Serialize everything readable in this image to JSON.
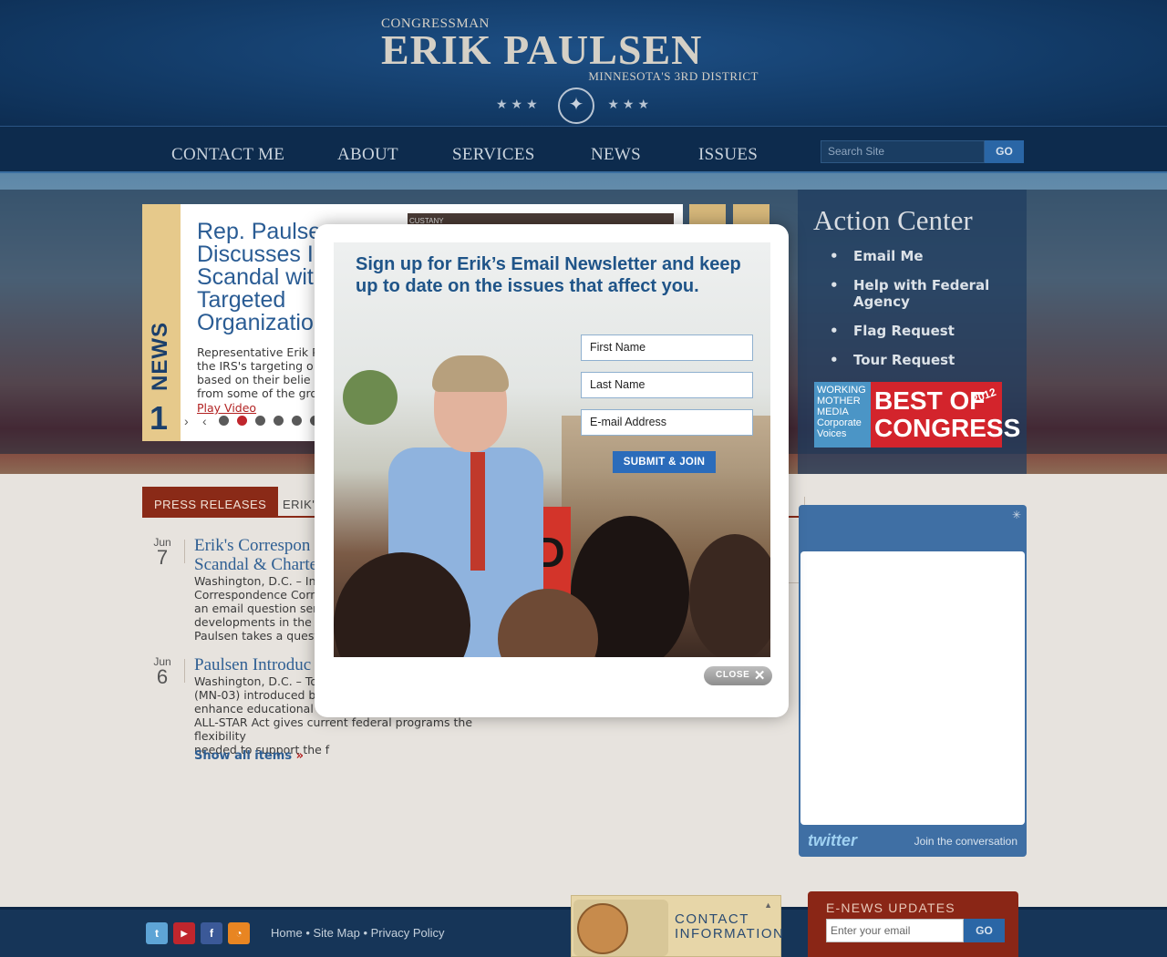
{
  "header": {
    "pre_title": "CONGRESSMAN",
    "name": "ERIK PAULSEN",
    "district": "MINNESOTA'S 3RD DISTRICT",
    "stars": "★★★"
  },
  "nav": {
    "items": [
      "CONTACT ME",
      "ABOUT",
      "SERVICES",
      "NEWS",
      "ISSUES"
    ],
    "search_placeholder": "Search Site",
    "search_button": "GO"
  },
  "slider": {
    "tab_label": "NEWS",
    "number": "1",
    "title": "Rep. Paulse\nDiscusses I\nScandal wit\nTargeted\nOrganizatio",
    "body": "Representative Erik Pa\nthe IRS's targeting o\nbased on their belie\nfrom some of the grou",
    "play_link": "Play Video",
    "thumb_label": "CUSTANY",
    "active_dot": 2
  },
  "action_center": {
    "title": "Action Center",
    "items": [
      "Email Me",
      "Help with Federal Agency",
      "Flag Request",
      "Tour Request"
    ],
    "badge": {
      "left_text": "WORKING MOTHER MEDIA Corporate Voices",
      "main_text": "BEST OF CONGRESS",
      "year": "2012"
    }
  },
  "content": {
    "tabs": [
      "PRESS RELEASES",
      "ERIK'S"
    ],
    "items": [
      {
        "month": "Jun",
        "day": "7",
        "title": "Erik's Correspon\nScandal & Charte",
        "body": "Washington, D.C. – In\nCorrespondence Corne\nan email question sent\ndevelopments in the u\nPaulsen takes a questi"
      },
      {
        "month": "Jun",
        "day": "6",
        "title": "Paulsen Introduc",
        "body": "Washington, D.C. – To\n(MN-03) introduced bi\nenhance educational o\nALL-STAR Act gives current federal programs the flexibility\nneeded to support the f"
      }
    ],
    "show_all": "Show all items",
    "show_all_arrow": "»"
  },
  "twitter": {
    "logo": "twitter",
    "join": "Join the conversation"
  },
  "footer": {
    "links": [
      "Home",
      "Site Map",
      "Privacy Policy"
    ],
    "separator": "•",
    "social_icons": [
      "twitter-icon",
      "youtube-icon",
      "facebook-icon",
      "rss-icon"
    ],
    "social_colors": [
      "#5ea4d6",
      "#c0262d",
      "#3b5998",
      "#e88522"
    ],
    "contact_title": "CONTACT\nINFORMATION",
    "enews_title": "E-NEWS UPDATES",
    "enews_placeholder": "Enter your email",
    "enews_button": "GO"
  },
  "modal": {
    "heading": "Sign up for Erik’s Email Newsletter and keep up to date on the issues that affect you.",
    "first_name": "First Name",
    "last_name": "Last Name",
    "email": "E-mail Address",
    "submit": "SUBMIT & JOIN",
    "sign_text": "EAD",
    "close": "CLOSE",
    "close_x": "✕"
  }
}
